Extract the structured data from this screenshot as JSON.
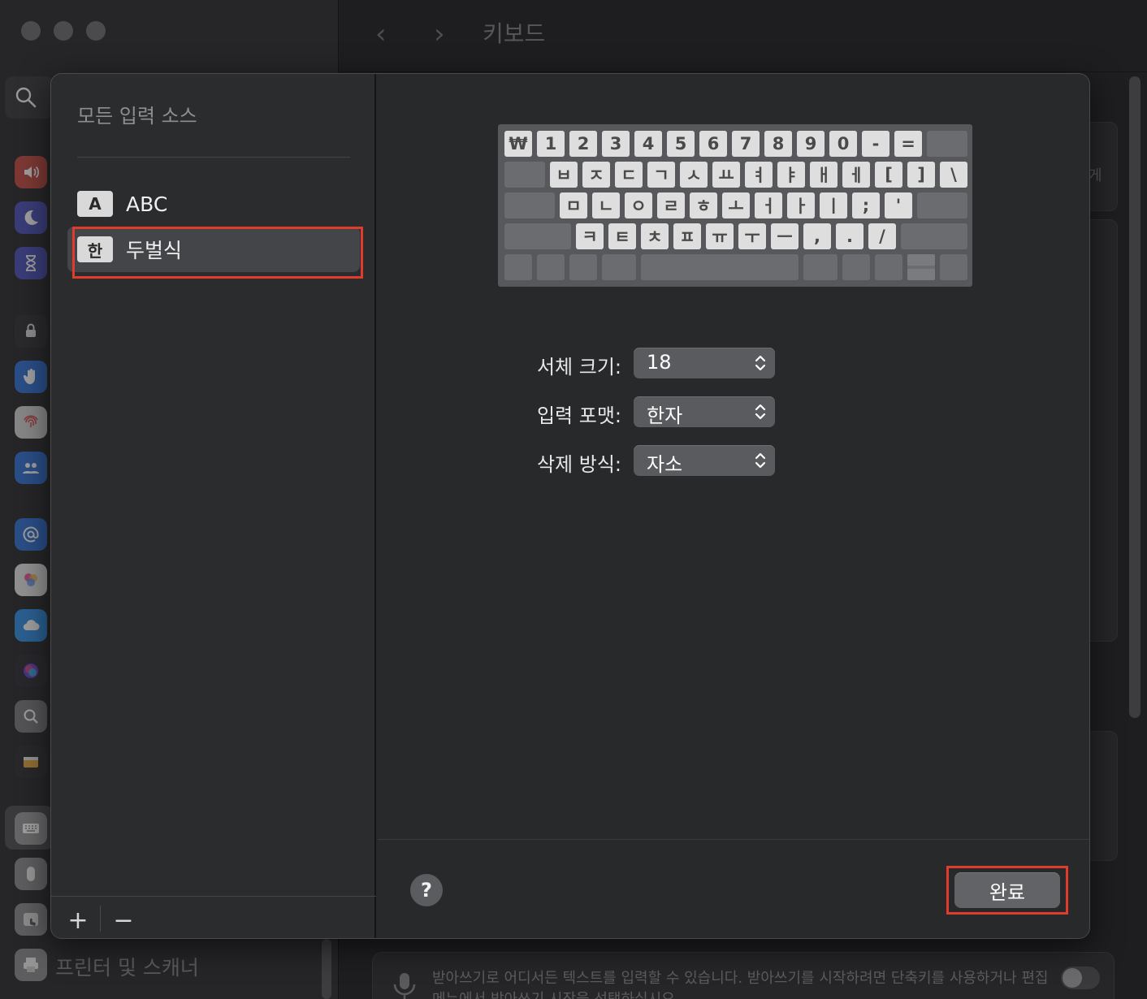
{
  "background": {
    "window_title": "키보드",
    "sidebar_last_item": "프린터 및 스캐너",
    "right_edge_text": "게",
    "dictation_text": "받아쓰기로 어디서든 텍스트를 입력할 수 있습니다. 받아쓰기를 시작하려면 단축키를 사용하거나 편집 메뉴에서 받아쓰기 시작을 선택하십시오.",
    "sidebar_icons": [
      "sound-icon",
      "moon-icon",
      "hourglass-icon",
      "lock-icon",
      "hand-icon",
      "fingerprint-icon",
      "people-icon",
      "at-icon",
      "game-center-icon",
      "icloud-icon",
      "siri-icon",
      "spotlight-icon",
      "wallet-icon",
      "keyboard-icon",
      "mouse-icon",
      "trackpad-icon",
      "printer-icon"
    ]
  },
  "sheet": {
    "left": {
      "title": "모든 입력 소스",
      "sources": [
        {
          "badge": "A",
          "label": "ABC",
          "selected": false
        },
        {
          "badge": "한",
          "label": "두벌식",
          "selected": true
        }
      ],
      "add_label": "+",
      "remove_label": "−"
    },
    "keyboard": {
      "row1": [
        "₩",
        "1",
        "2",
        "3",
        "4",
        "5",
        "6",
        "7",
        "8",
        "9",
        "0",
        "-",
        "=",
        ""
      ],
      "row2": [
        "",
        "ㅂ",
        "ㅈ",
        "ㄷ",
        "ㄱ",
        "ㅅ",
        "ㅛ",
        "ㅕ",
        "ㅑ",
        "ㅐ",
        "ㅔ",
        "[",
        "]",
        "\\"
      ],
      "row3": [
        "",
        "ㅁ",
        "ㄴ",
        "ㅇ",
        "ㄹ",
        "ㅎ",
        "ㅗ",
        "ㅓ",
        "ㅏ",
        "ㅣ",
        ";",
        "'",
        ""
      ],
      "row4": [
        "",
        "ㅋ",
        "ㅌ",
        "ㅊ",
        "ㅍ",
        "ㅠ",
        "ㅜ",
        "ㅡ",
        ",",
        ".",
        "/",
        ""
      ],
      "row5": [
        "",
        "",
        "",
        "",
        "",
        "",
        "",
        "",
        "",
        ""
      ]
    },
    "options": [
      {
        "label": "서체 크기:",
        "value": "18"
      },
      {
        "label": "입력 포맷:",
        "value": "한자"
      },
      {
        "label": "삭제 방식:",
        "value": "자소"
      }
    ],
    "help_label": "?",
    "done_label": "완료"
  },
  "colors": {
    "highlight": "#e03c2c",
    "sheet_bg": "#27282a",
    "keycap": "#dedede"
  }
}
